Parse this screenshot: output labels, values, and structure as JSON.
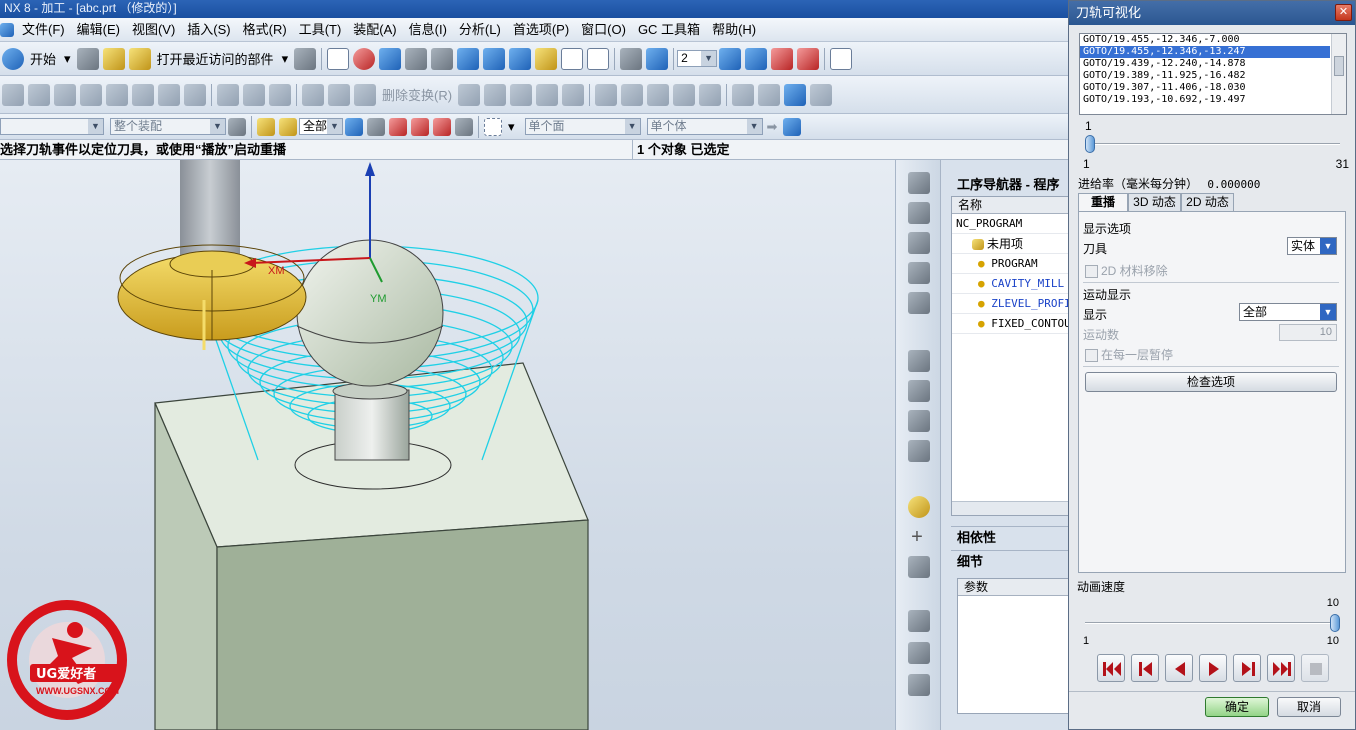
{
  "window": {
    "title": "NX 8 - 加工 - [abc.prt （修改的）]"
  },
  "menubar": [
    "文件(F)",
    "编辑(E)",
    "视图(V)",
    "插入(S)",
    "格式(R)",
    "工具(T)",
    "装配(A)",
    "信息(I)",
    "分析(L)",
    "首选项(P)",
    "窗口(O)",
    "GC 工具箱",
    "帮助(H)"
  ],
  "toolbar1": {
    "start_label": "开始",
    "recent_label": "打开最近访问的部件",
    "layer_value": "2"
  },
  "toolbar2": {
    "delete_transform_label": "删除变换(R)"
  },
  "toolbar3": {
    "assembly_filter": "整个装配",
    "type_filter": "全部",
    "face_rule": "单个面",
    "body_rule": "单个体"
  },
  "cue": {
    "message": "选择刀轨事件以定位刀具，或使用“播放”启动重播",
    "selection": "1 个对象 已选定"
  },
  "viewport": {
    "axis_x": "XM",
    "axis_y": "YM",
    "watermark_brand": "UG爱好者",
    "watermark_url": "WWW.UGSNX.COM"
  },
  "navigator": {
    "title": "工序导航器 - 程序",
    "column_name": "名称",
    "root": "NC_PROGRAM",
    "items": [
      "未用项",
      "PROGRAM",
      "CAVITY_MILL",
      "ZLEVEL_PROFILE",
      "FIXED_CONTOUR"
    ],
    "dependency_label": "相依性",
    "details_label": "细节",
    "details_column": "参数"
  },
  "dialog": {
    "title": "刀轨可视化",
    "goto_lines": [
      "GOTO/19.455,-12.346,-7.000",
      "GOTO/19.455,-12.346,-13.247",
      "GOTO/19.439,-12.240,-14.878",
      "GOTO/19.389,-11.925,-16.482",
      "GOTO/19.307,-11.406,-18.030",
      "GOTO/19.193,-10.692,-19.497"
    ],
    "selected_goto_index": 1,
    "position": {
      "value": 1,
      "min": "1",
      "max": "31",
      "value_label": "1"
    },
    "feed_rate_label": "进给率（毫米每分钟）",
    "feed_rate_value": "0.000000",
    "tabs": [
      "重播",
      "3D 动态",
      "2D 动态"
    ],
    "display_options_label": "显示选项",
    "tool_label": "刀具",
    "tool_value": "实体",
    "material_removal_label": "2D 材料移除",
    "motion_display_label": "运动显示",
    "display_label": "显示",
    "display_value": "全部",
    "motion_count_label": "运动数",
    "motion_count_value": "10",
    "pause_label": "在每一层暂停",
    "check_options_label": "检查选项",
    "anim_speed_label": "动画速度",
    "anim_speed": {
      "value": 10,
      "min": "1",
      "max": "10",
      "value_label": "10"
    },
    "ok_label": "确定",
    "cancel_label": "取消"
  }
}
